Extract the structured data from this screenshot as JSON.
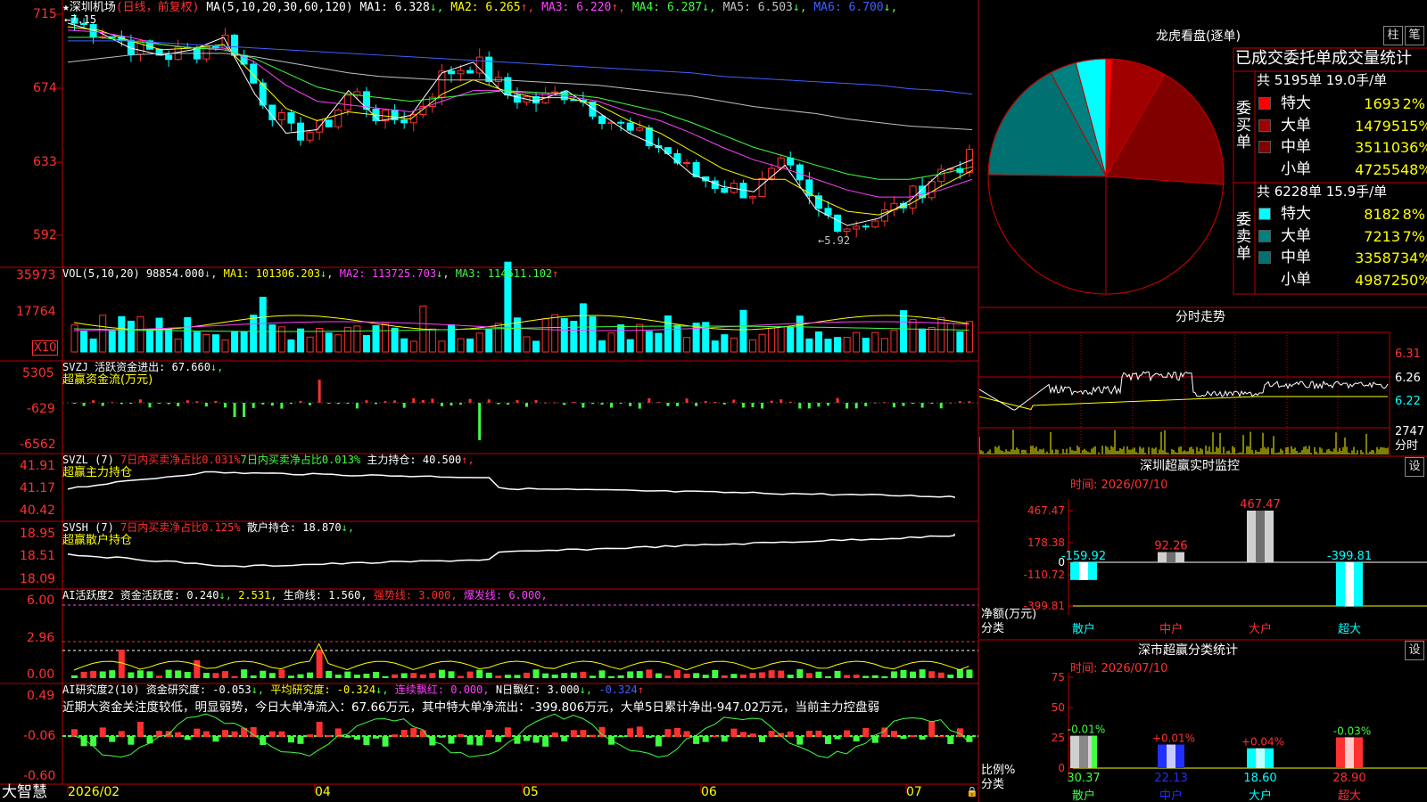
{
  "stock": {
    "star": "★",
    "name": "深圳机场",
    "period": "(日线，前复权)",
    "ma_label": "MA(5,10,20,30,60,120)",
    "ma": [
      {
        "label": "MA1:",
        "value": "6.328",
        "arrow": "↓",
        "color": "#ffffff"
      },
      {
        "label": "MA2:",
        "value": "6.265",
        "arrow": "↑",
        "color": "#ffff00"
      },
      {
        "label": "MA3:",
        "value": "6.220",
        "arrow": "↑",
        "color": "#ff40ff"
      },
      {
        "label": "MA4:",
        "value": "6.287",
        "arrow": "↓",
        "color": "#40ff40"
      },
      {
        "label": "MA5:",
        "value": "6.503",
        "arrow": "↓",
        "color": "#c0c0c0"
      },
      {
        "label": "MA6:",
        "value": "6.700",
        "arrow": "↓",
        "color": "#4060ff"
      }
    ],
    "high_marker": "←7.15",
    "low_marker": "←5.92",
    "price_axis": [
      "715",
      "674",
      "633",
      "592"
    ]
  },
  "vol": {
    "title": "VOL(5,10,20)",
    "value": "98854.000",
    "arrow": "↓",
    "ma1": "MA1: 101306.203",
    "ma1_arrow": "↓",
    "ma2": "MA2: 113725.703",
    "ma2_arrow": "↓",
    "ma3": "MA3: 114511.102",
    "ma3_arrow": "↑",
    "axis": [
      "35973",
      "17764"
    ],
    "unit": "X10"
  },
  "svzj": {
    "title": "SVZJ",
    "label": "活跃资金进出: 67.660",
    "arrow": "↓,",
    "sub": "超赢资金流(万元)",
    "axis": [
      "5305",
      "-629",
      "-6562"
    ]
  },
  "svzl": {
    "title": "SVZL (7)",
    "a": "7日内买卖净占比0.031%",
    "b": "7日内买卖净占比0.013%",
    "c": "主力持仓: 40.500",
    "arrow": "↑,",
    "sub": "超赢主力持仓",
    "axis": [
      "41.91",
      "41.17",
      "40.42"
    ]
  },
  "svsh": {
    "title": "SVSH (7)",
    "a": "7日内买卖净占比0.125%",
    "c": "散户持仓: 18.870",
    "arrow": "↓,",
    "sub": "超赢散户持仓",
    "axis": [
      "18.95",
      "18.51",
      "18.09"
    ]
  },
  "ai1": {
    "title": "AI活跃度2",
    "a": "资金活跃度: 0.240",
    "a_arrow": "↓,",
    "b": "2.531,",
    "c": "生命线: 1.560,",
    "d": "强势线: 3.000,",
    "e": "爆发线: 6.000,",
    "axis": [
      "6.00",
      "2.96",
      "0.00"
    ]
  },
  "ai2": {
    "title": "AI研究度2(10)",
    "a": "资金研究度: -0.053",
    "a_arrow": "↓,",
    "b": "平均研究度: -0.324",
    "b_arrow": "↓,",
    "c": "连续飘红: 0.000,",
    "d": "N日飘红: 3.000",
    "d_arrow": "↓,",
    "e": "-0.324",
    "e_arrow": "↑",
    "comment": "近期大资金关注度较低，明显弱势，今日大单净流入：67.66万元，其中特大单净流出：-399.806万元，大单5日累计净出-947.02万元，当前主力控盘弱",
    "axis": [
      "0.49",
      "-0.06",
      "-0.60"
    ]
  },
  "bottom": {
    "app": "大智慧",
    "dates": [
      "2026/02",
      "04",
      "05",
      "06",
      "07"
    ]
  },
  "dragon": {
    "title": "龙虎看盘(逐单)",
    "btn_pillar": "柱",
    "btn_pen": "笔",
    "heading": "已成交委托单成交量统计",
    "buy_total": "共 5195单 19.0手/单",
    "buy_side": "委买单",
    "buy_rows": [
      {
        "name": "特大",
        "value": "1693",
        "pct": "2%",
        "color": "#ff0000"
      },
      {
        "name": "大单",
        "value": "14795",
        "pct": "15%",
        "color": "#a00000"
      },
      {
        "name": "中单",
        "value": "35110",
        "pct": "36%",
        "color": "#800000"
      },
      {
        "name": "小单",
        "value": "47255",
        "pct": "48%",
        "color": "#000000"
      }
    ],
    "sell_total": "共 6228单 15.9手/单",
    "sell_side": "委卖单",
    "sell_rows": [
      {
        "name": "特大",
        "value": "8182",
        "pct": "8%",
        "color": "#00ffff"
      },
      {
        "name": "大单",
        "value": "7213",
        "pct": "7%",
        "color": "#008080"
      },
      {
        "name": "中单",
        "value": "33587",
        "pct": "34%",
        "color": "#007070"
      },
      {
        "name": "小单",
        "value": "49872",
        "pct": "50%",
        "color": "#000000"
      }
    ]
  },
  "intraday": {
    "title": "分时走势",
    "axis": [
      "6.31",
      "6.26",
      "6.22"
    ],
    "vol_axis": "2747",
    "vol_unit": "分时"
  },
  "monitor": {
    "title": "深圳超赢实时监控",
    "btn": "设",
    "time": "时间: 2026/07/10",
    "axis": [
      "467.47",
      "178.38",
      "0",
      "-110.72",
      "-399.81"
    ],
    "ylabel": "净额(万元)",
    "xlabel": "分类",
    "cats": [
      "散户",
      "中户",
      "大户",
      "超大"
    ],
    "labels": [
      "-159.92",
      "92.26",
      "467.47",
      "-399.81"
    ]
  },
  "classify": {
    "title": "深市超赢分类统计",
    "btn": "设",
    "time": "时间: 2026/07/10",
    "axis": [
      "75",
      "50",
      "25",
      "0"
    ],
    "ylabel": "比例%",
    "xlabel": "分类",
    "cats": [
      "散户",
      "中户",
      "大户",
      "超大"
    ],
    "top_labels": [
      "-0.01%",
      "+0.01%",
      "+0.04%",
      "-0.03%"
    ],
    "bottom_labels": [
      "30.37",
      "22.13",
      "18.60",
      "28.90"
    ]
  },
  "chart_data": [
    {
      "type": "pie",
      "title": "龙虎看盘(逐单)",
      "categories": [
        "委买特大",
        "委买大单",
        "委买中单",
        "委买小单",
        "委卖特大",
        "委卖大单",
        "委卖中单",
        "委卖小单"
      ],
      "values": [
        1693,
        14795,
        35110,
        47255,
        8182,
        7213,
        33587,
        49872
      ]
    },
    {
      "type": "bar",
      "title": "深圳超赢实时监控",
      "categories": [
        "散户",
        "中户",
        "大户",
        "超大"
      ],
      "values": [
        -159.92,
        92.26,
        467.47,
        -399.81
      ],
      "ylim": [
        -399.81,
        467.47
      ],
      "ylabel": "净额(万元)",
      "xlabel": "分类"
    },
    {
      "type": "bar",
      "title": "深市超赢分类统计",
      "categories": [
        "散户",
        "中户",
        "大户",
        "超大"
      ],
      "values": [
        30.37,
        22.13,
        18.6,
        28.9
      ],
      "changes": [
        "-0.01%",
        "+0.01%",
        "+0.04%",
        "-0.03%"
      ],
      "ylim": [
        0,
        75
      ],
      "ylabel": "比例%",
      "xlabel": "分类"
    },
    {
      "type": "line",
      "title": "深圳机场",
      "xlabel": "",
      "ylabel": "",
      "ylim": [
        5.8,
        7.2
      ],
      "x": [
        "2026/02",
        "04",
        "05",
        "06",
        "07"
      ],
      "series": [
        {
          "name": "MA1",
          "values": [
            7.1,
            7.05,
            6.96,
            6.92,
            6.95,
            7.02,
            6.7,
            6.48,
            6.5,
            6.72,
            6.55,
            6.58,
            6.82,
            6.88,
            6.7,
            6.66,
            6.72,
            6.6,
            6.48,
            6.4,
            6.25,
            6.18,
            6.15,
            6.3,
            6.05,
            5.96,
            6.0,
            6.1,
            6.26,
            6.33
          ]
        },
        {
          "name": "MA2",
          "values": [
            7.08,
            7.06,
            7.0,
            6.95,
            6.96,
            6.98,
            6.8,
            6.62,
            6.55,
            6.6,
            6.58,
            6.56,
            6.7,
            6.78,
            6.72,
            6.68,
            6.68,
            6.64,
            6.55,
            6.48,
            6.38,
            6.28,
            6.22,
            6.22,
            6.12,
            6.04,
            6.02,
            6.08,
            6.18,
            6.27
          ]
        },
        {
          "name": "MA3",
          "values": [
            7.06,
            7.05,
            7.02,
            6.98,
            6.96,
            6.96,
            6.88,
            6.75,
            6.66,
            6.64,
            6.62,
            6.6,
            6.66,
            6.72,
            6.72,
            6.7,
            6.69,
            6.66,
            6.6,
            6.55,
            6.48,
            6.4,
            6.33,
            6.28,
            6.22,
            6.16,
            6.12,
            6.12,
            6.16,
            6.22
          ]
        },
        {
          "name": "MA4",
          "values": [
            7.02,
            7.02,
            7.0,
            6.98,
            6.96,
            6.95,
            6.9,
            6.82,
            6.74,
            6.7,
            6.68,
            6.66,
            6.68,
            6.7,
            6.72,
            6.71,
            6.7,
            6.68,
            6.64,
            6.6,
            6.54,
            6.47,
            6.4,
            6.35,
            6.3,
            6.25,
            6.22,
            6.22,
            6.25,
            6.29
          ]
        },
        {
          "name": "MA5",
          "values": [
            6.88,
            6.9,
            6.92,
            6.93,
            6.93,
            6.93,
            6.91,
            6.88,
            6.85,
            6.82,
            6.8,
            6.79,
            6.78,
            6.78,
            6.78,
            6.77,
            6.76,
            6.75,
            6.73,
            6.71,
            6.69,
            6.66,
            6.63,
            6.61,
            6.59,
            6.56,
            6.54,
            6.52,
            6.51,
            6.5
          ]
        },
        {
          "name": "MA6",
          "values": [
            7.0,
            7.0,
            7.0,
            6.99,
            6.98,
            6.97,
            6.96,
            6.95,
            6.94,
            6.93,
            6.92,
            6.91,
            6.9,
            6.89,
            6.88,
            6.87,
            6.86,
            6.85,
            6.84,
            6.83,
            6.82,
            6.8,
            6.79,
            6.78,
            6.77,
            6.76,
            6.75,
            6.73,
            6.72,
            6.7
          ]
        }
      ]
    }
  ]
}
